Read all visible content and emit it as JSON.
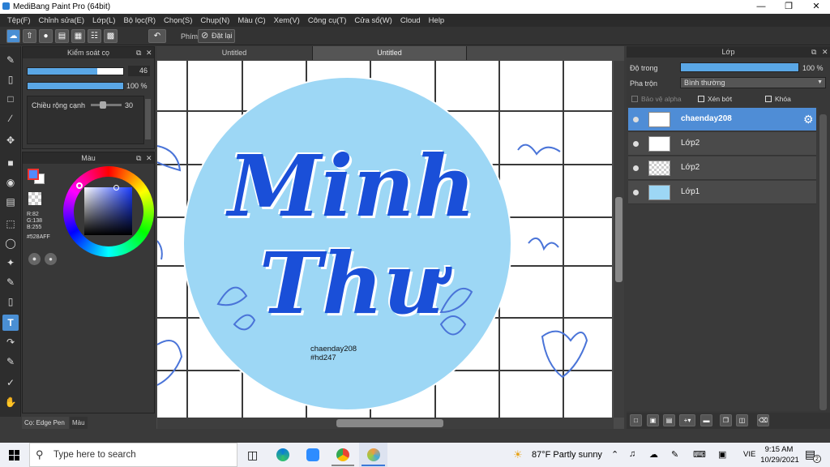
{
  "window": {
    "title": "MediBang Paint Pro (64bit)"
  },
  "menu": [
    "Tệp(F)",
    "Chỉnh sửa(E)",
    "Lớp(L)",
    "Bộ lọc(R)",
    "Chọn(S)",
    "Chụp(N)",
    "Màu (C)",
    "Xem(V)",
    "Công cụ(T)",
    "Cửa sổ(W)",
    "Cloud",
    "Help"
  ],
  "toolbar": {
    "key_label": "Phím",
    "reset_label": "Đặt lại"
  },
  "brush_panel": {
    "title": "Kiểm soát cọ",
    "size_value": "46",
    "opacity_value": "100 %",
    "edge_label": "Chiều rộng cạnh",
    "edge_value": "30",
    "size_fraction": 0.73,
    "opacity_fraction": 1.0,
    "edge_fraction": 0.3
  },
  "color_panel": {
    "title": "Màu",
    "rgb_r": "R:82",
    "rgb_g": "G:138",
    "rgb_b": "B:255",
    "hex": "#528AFF",
    "primary_color": "#528aff"
  },
  "bottom_tabs": {
    "brush_tab": "Cọ: Edge Pen",
    "color_tab": "Màu"
  },
  "canvas": {
    "tabs": [
      "Untitled",
      "Untitled"
    ],
    "artwork_text": "Minh Thư",
    "signature_line1": "chaenday208",
    "signature_line2": "#hd247",
    "circle_color": "#9dd7f5",
    "lettering_color": "#1a4fd8"
  },
  "layer_panel": {
    "title": "Lớp",
    "opacity_label": "Độ trong",
    "opacity_value": "100 %",
    "blend_label": "Pha trộn",
    "blend_value": "Bình thường",
    "protect_alpha": "Bảo vệ alpha",
    "clipping": "Xén bớt",
    "lock": "Khóa",
    "layers": [
      {
        "name": "chaenday208",
        "selected": true
      },
      {
        "name": "Lớp2",
        "selected": false
      },
      {
        "name": "Lớp2",
        "selected": false
      },
      {
        "name": "Lớp1",
        "selected": false
      }
    ]
  },
  "taskbar": {
    "search_placeholder": "Type here to search",
    "weather": "87°F  Partly sunny",
    "language": "VIE",
    "time": "9:15 AM",
    "date": "10/29/2021",
    "notification_count": "2"
  }
}
